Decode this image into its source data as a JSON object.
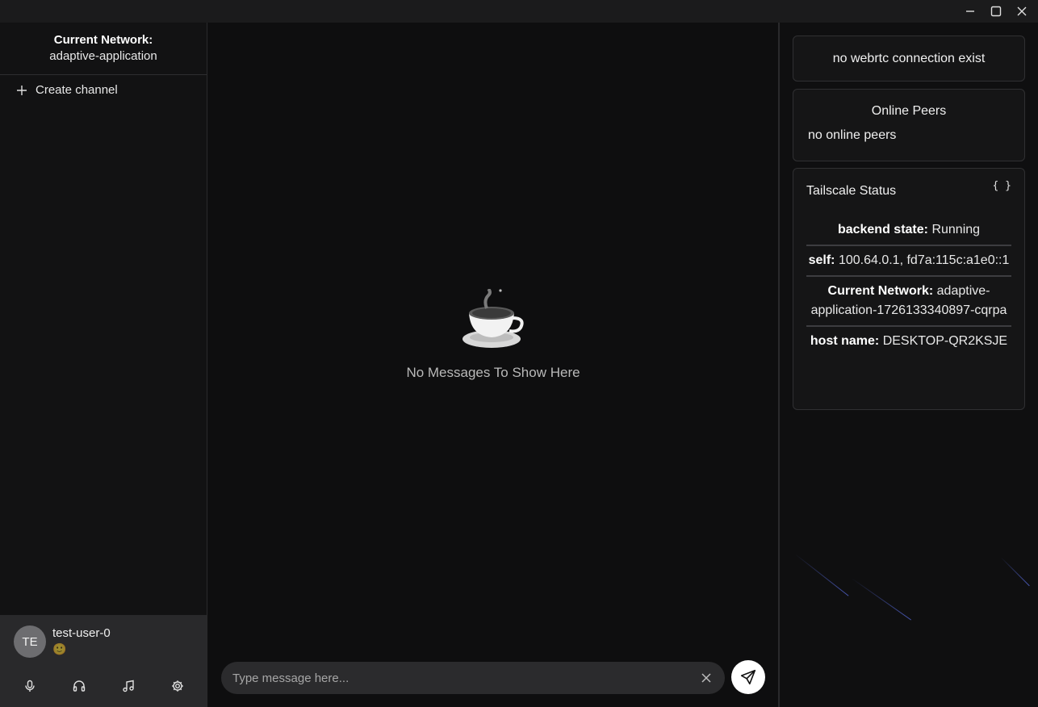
{
  "window": {
    "minimize_icon": "minimize-icon",
    "maximize_icon": "maximize-icon",
    "close_icon": "close-icon"
  },
  "sidebar": {
    "network_label": "Current Network:",
    "network_value": "adaptive-application",
    "create_channel": "Create channel"
  },
  "user": {
    "initials": "TE",
    "name": "test-user-0",
    "status_emoji": "🙂",
    "controls": [
      "microphone-icon",
      "headphones-icon",
      "music-icon",
      "settings-icon"
    ]
  },
  "main": {
    "empty_icon": "☕",
    "empty_text": "No Messages To Show Here",
    "composer_placeholder": "Type message here..."
  },
  "right": {
    "webrtc_status": "no webrtc connection exist",
    "peers_title": "Online Peers",
    "peers_empty": "no online peers",
    "tailscale_title": "Tailscale Status",
    "json_toggle": "{ }",
    "rows": [
      {
        "label": "backend state:",
        "value": "Running"
      },
      {
        "label": "self:",
        "value": "100.64.0.1, fd7a:115c:a1e0::1"
      },
      {
        "label": "Current Network:",
        "value": "adaptive-application-1726133340897-cqrpa"
      },
      {
        "label": "host name:",
        "value": "DESKTOP-QR2KSJE"
      }
    ]
  }
}
